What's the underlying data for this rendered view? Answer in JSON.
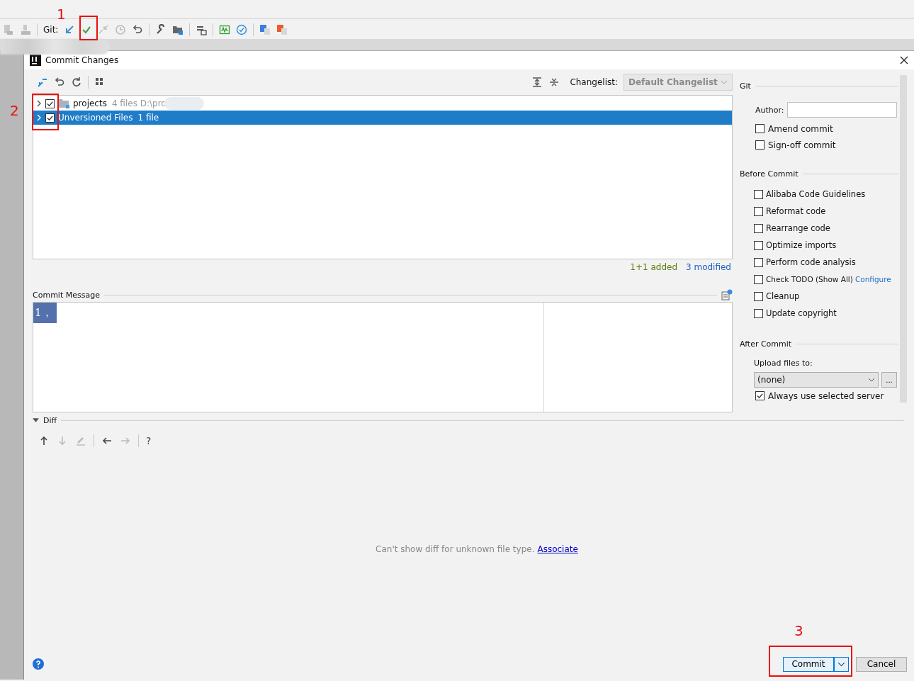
{
  "toolbar": {
    "vcs_label": "Git:"
  },
  "annotations": [
    {
      "label": "1"
    },
    {
      "label": "2"
    },
    {
      "label": "3"
    }
  ],
  "dialog": {
    "title": "Commit Changes",
    "changes": {
      "changelist_label": "Changelist:",
      "changelist": "Default Changelist",
      "rows": [
        {
          "kind": "folder",
          "name": "projects",
          "detail": "4 files  D:\\pro",
          "checked": true,
          "selected": false,
          "expanded": false
        },
        {
          "kind": "group",
          "name": "Unversioned Files",
          "detail": "1 file",
          "checked": true,
          "selected": true,
          "expanded": false
        }
      ],
      "summary": [
        {
          "text": "1+1 added",
          "color": "#5b7b12"
        },
        {
          "text": "3 modified",
          "color": "#2060c0"
        }
      ]
    },
    "commit_message": {
      "label": "Commit Message",
      "value": "1，"
    },
    "git": {
      "title": "Git",
      "author_label": "Author:",
      "options": [
        {
          "label": "Amend commit",
          "checked": false
        },
        {
          "label": "Sign-off commit",
          "checked": false
        }
      ]
    },
    "before_commit": {
      "title": "Before Commit",
      "options": [
        {
          "label": "Alibaba Code Guidelines",
          "checked": false
        },
        {
          "label": "Reformat code",
          "checked": false
        },
        {
          "label": "Rearrange code",
          "checked": false
        },
        {
          "label": "Optimize imports",
          "checked": false
        },
        {
          "label": "Perform code analysis",
          "checked": false
        },
        {
          "label": "Check TODO (Show All)",
          "checked": false,
          "link": "Configure"
        },
        {
          "label": "Cleanup",
          "checked": false
        },
        {
          "label": "Update copyright",
          "checked": false
        }
      ]
    },
    "after_commit": {
      "title": "After Commit",
      "upload_label": "Upload files to:",
      "server": "(none)",
      "browse": "...",
      "options": [
        {
          "label": "Always use selected server",
          "checked": true
        }
      ]
    },
    "diff": {
      "title": "Diff",
      "expanded": true,
      "help": "?",
      "message": "Can't show diff for unknown file type.",
      "link": "Associate"
    },
    "buttons": {
      "commit": "Commit",
      "cancel": "Cancel"
    }
  }
}
